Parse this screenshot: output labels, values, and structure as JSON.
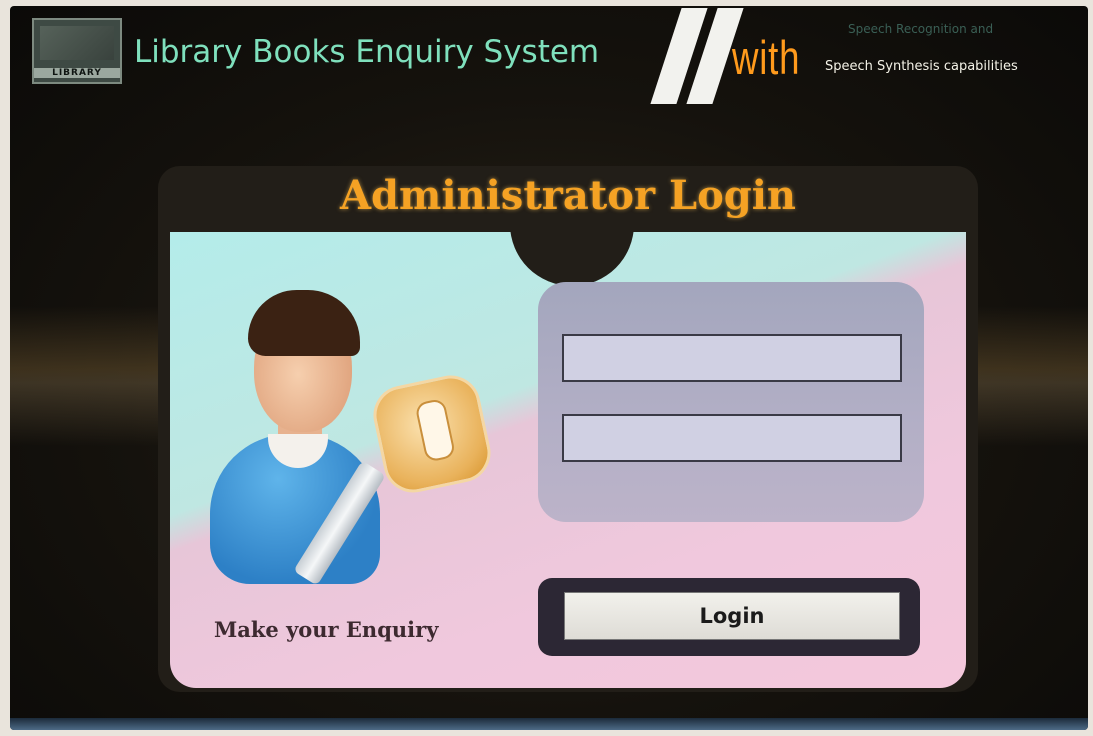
{
  "header": {
    "logo_text": "LIBRARY",
    "app_title": "Library Books Enquiry System",
    "with_word": "with",
    "speech_recognition": "Speech Recognition and",
    "speech_synthesis": "Speech Synthesis capabilities"
  },
  "panel": {
    "title": "Administrator Login",
    "enquiry_label": "Make your Enquiry",
    "username": {
      "value": "",
      "placeholder": ""
    },
    "password": {
      "value": "",
      "placeholder": ""
    },
    "login_label": "Login"
  },
  "colors": {
    "title_accent": "#f5a224",
    "app_title": "#7fe0bd",
    "with_word": "#ff9a1c"
  },
  "icons": {
    "logo": "library-logo-icon",
    "avatar": "admin-user-avatar-icon",
    "key": "key-icon"
  }
}
